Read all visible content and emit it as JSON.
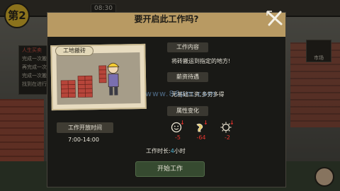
{
  "background": {
    "day_badge": "第2",
    "chips": [
      "08:30",
      "",
      "",
      ""
    ],
    "quest_panel": {
      "title": "人生买卖",
      "rows": [
        "完成一次搬",
        "再完成一次",
        "完成一次搬",
        "找到在进行"
      ]
    },
    "shop_label": "市场"
  },
  "dialog": {
    "title": "要开启此工作吗?",
    "job_name": "工地搬砖",
    "work_content_label": "工作内容",
    "work_content_text": "将砖搬运到指定的地方!",
    "salary_label": "薪资待遇",
    "salary_text": "无基础工资,多劳多得",
    "attribute_label": "属性变化",
    "open_time_label": "工作开放时间",
    "open_time_value": "7:00-14:00",
    "duration_prefix": "工作时长:",
    "duration_value": "4",
    "duration_unit": "小时",
    "start_button": "开始工作"
  },
  "attributes": [
    {
      "icon": "mood-icon",
      "value": "-5"
    },
    {
      "icon": "hunger-icon",
      "value": "-64"
    },
    {
      "icon": "energy-icon",
      "value": "-2"
    }
  ],
  "watermark": "www.86pm.com",
  "colors": {
    "header": "#b89a63",
    "dialog_bg": "#191916",
    "negative_value": "#e8362f",
    "duration_number": "#51b8d8",
    "start_button": "#364a30"
  }
}
